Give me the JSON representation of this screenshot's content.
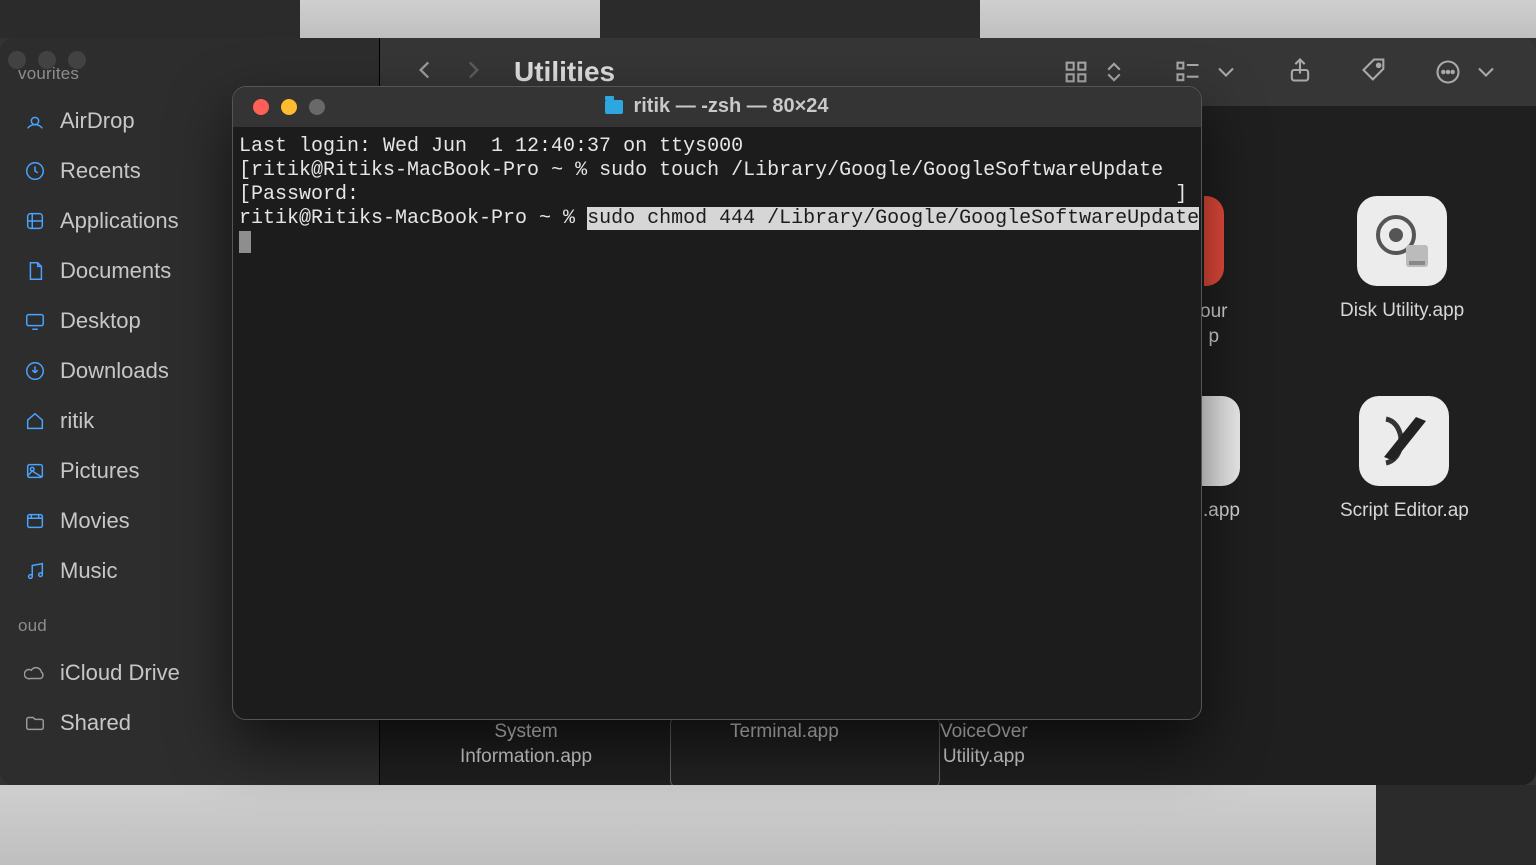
{
  "finder": {
    "title": "Utilities",
    "sidebar": {
      "section1": "vourites",
      "items": [
        "AirDrop",
        "Recents",
        "Applications",
        "Documents",
        "Desktop",
        "Downloads",
        "ritik",
        "Pictures",
        "Movies",
        "Music"
      ],
      "section2": "oud",
      "cloud": [
        "iCloud Drive",
        "Shared"
      ]
    },
    "apps_row1": [
      {
        "fragment1": "our",
        "fragment2": "p"
      },
      {
        "label": "Disk Utility.app"
      }
    ],
    "apps_row2": [
      {
        "label": ".app"
      },
      {
        "label": "Script Editor.ap"
      }
    ],
    "apps_bottom": [
      {
        "line1": "System",
        "line2": "Information.app"
      },
      {
        "line1": "Terminal.app",
        "line2": ""
      },
      {
        "line1": "VoiceOver",
        "line2": "Utility.app"
      }
    ]
  },
  "terminal": {
    "title": "ritik — -zsh — 80×24",
    "lines": {
      "lastlogin": "Last login: Wed Jun  1 12:40:37 on ttys000",
      "bracket_open": "[",
      "bracket_close": "]",
      "prompt": "ritik@Ritiks-MacBook-Pro ~ % ",
      "cmd1_a": "sudo touch /Library/Google/GoogleSoftwareUpdate",
      "password": "Password:",
      "cmd2_sel": "sudo chmod 444 /Library/Google/GoogleSoftwareUpdate"
    }
  }
}
